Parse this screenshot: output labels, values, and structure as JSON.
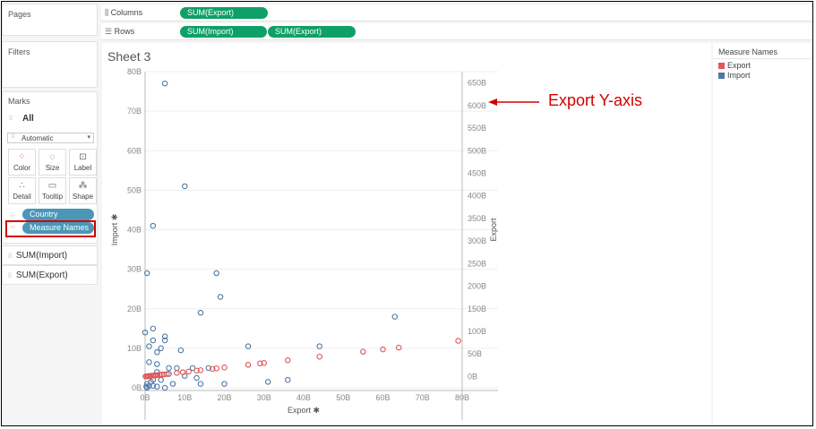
{
  "shelves": {
    "pages_label": "Pages",
    "columns_label": "Columns",
    "columns_pills": [
      "SUM(Export)"
    ],
    "rows_label": "Rows",
    "rows_pills": [
      "SUM(Import)",
      "SUM(Export)"
    ]
  },
  "filters": {
    "label": "Filters"
  },
  "marks": {
    "label": "Marks",
    "all_label": "All",
    "mark_type": "Automatic",
    "buttons": [
      "Color",
      "Size",
      "Label",
      "Detail",
      "Tooltip",
      "Shape"
    ],
    "pills": [
      "Country",
      "Measure Names"
    ],
    "measures": [
      "SUM(Import)",
      "SUM(Export)"
    ]
  },
  "sheet": {
    "title": "Sheet 3"
  },
  "legend": {
    "title": "Measure Names",
    "items": [
      {
        "label": "Export",
        "color": "#e15759"
      },
      {
        "label": "Import",
        "color": "#4e79a7"
      }
    ]
  },
  "annotation": {
    "text": "Export Y-axis",
    "color": "#d00000"
  },
  "chart_data": {
    "type": "scatter",
    "xlabel": "Export",
    "ylabel_left": "Import",
    "ylabel_right": "Export",
    "x_ticks": [
      "0B",
      "10B",
      "20B",
      "30B",
      "40B",
      "50B",
      "60B",
      "70B",
      "80B"
    ],
    "y_left_ticks": [
      "0B",
      "10B",
      "20B",
      "30B",
      "40B",
      "50B",
      "60B",
      "70B",
      "80B"
    ],
    "y_right_ticks": [
      "0B",
      "50B",
      "100B",
      "150B",
      "200B",
      "250B",
      "300B",
      "350B",
      "400B",
      "450B",
      "500B",
      "550B",
      "600B",
      "650B"
    ],
    "xlim": [
      0,
      80
    ],
    "y_left_lim": [
      0,
      80
    ],
    "y_right_lim": [
      -25,
      675
    ],
    "series": [
      {
        "name": "Import",
        "axis": "left",
        "color": "#4e79a7",
        "points": [
          [
            5,
            77
          ],
          [
            10,
            51
          ],
          [
            2,
            41
          ],
          [
            0.5,
            29
          ],
          [
            18,
            29
          ],
          [
            19,
            23
          ],
          [
            14,
            19
          ],
          [
            63,
            18
          ],
          [
            2,
            15
          ],
          [
            0,
            14
          ],
          [
            5,
            13
          ],
          [
            2,
            12
          ],
          [
            5,
            12
          ],
          [
            1,
            10.5
          ],
          [
            26,
            10.5
          ],
          [
            44,
            10.5
          ],
          [
            4,
            10
          ],
          [
            9,
            9.5
          ],
          [
            3,
            9
          ],
          [
            1,
            6.5
          ],
          [
            3,
            6
          ],
          [
            6,
            5
          ],
          [
            8,
            5
          ],
          [
            12,
            5
          ],
          [
            16,
            5
          ],
          [
            3,
            4
          ],
          [
            6,
            3.5
          ],
          [
            10,
            3
          ],
          [
            13,
            2.5
          ],
          [
            2,
            2
          ],
          [
            4,
            2
          ],
          [
            1.5,
            1.5
          ],
          [
            7,
            1
          ],
          [
            14,
            1
          ],
          [
            20,
            1
          ],
          [
            31,
            1.5
          ],
          [
            36,
            2
          ],
          [
            0.5,
            1
          ],
          [
            1,
            0.5
          ],
          [
            0.3,
            0.3
          ],
          [
            2,
            0.5
          ],
          [
            3,
            0.3
          ],
          [
            5,
            0
          ],
          [
            0.5,
            0
          ]
        ]
      },
      {
        "name": "Export",
        "axis": "right",
        "color": "#e15759",
        "points": [
          [
            0.1,
            0.1
          ],
          [
            0.4,
            0.4
          ],
          [
            0.7,
            0.7
          ],
          [
            1,
            1
          ],
          [
            1.3,
            1.3
          ],
          [
            1.6,
            1.6
          ],
          [
            2,
            2
          ],
          [
            2.4,
            2.4
          ],
          [
            2.8,
            2.8
          ],
          [
            3.2,
            3.2
          ],
          [
            3.7,
            3.7
          ],
          [
            4.2,
            4.2
          ],
          [
            4.8,
            4.8
          ],
          [
            5.5,
            5.5
          ],
          [
            8,
            8
          ],
          [
            9.5,
            9.5
          ],
          [
            11,
            11
          ],
          [
            13,
            13
          ],
          [
            14,
            14
          ],
          [
            17,
            17
          ],
          [
            18,
            18
          ],
          [
            20,
            20
          ],
          [
            26,
            26
          ],
          [
            29,
            29
          ],
          [
            30,
            30
          ],
          [
            36,
            36
          ],
          [
            44,
            44
          ],
          [
            55,
            55
          ],
          [
            60,
            60
          ],
          [
            64,
            64
          ],
          [
            79,
            79
          ]
        ]
      }
    ]
  }
}
